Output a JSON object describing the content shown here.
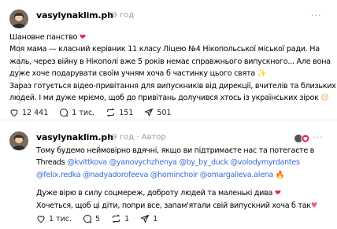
{
  "post1": {
    "username": "vasylynaklim.ph",
    "time": "19 год",
    "more": "···",
    "greeting": "Шановне панство",
    "body_lines": [
      "Моя мама — класний керівник 11 класу Ліцею №4 Нікопольської міської ради. На",
      "жаль, через війну в Нікополі вже 5 років немає справжнього випускного... Але вона",
      "дуже хоче подарувати своїм учням хоча б частинку цього свята",
      "Зараз готується відео-привітання для випускників від дирекції, вчителів та близьких",
      "людей. І ми дуже мріємо, щоб до привітань долучився хтось із українських зірок"
    ],
    "likes": "12 441",
    "comments": "1 тис.",
    "reposts": "151",
    "shares": "501"
  },
  "post2": {
    "username": "vasylynaklim.ph",
    "time": "19 год",
    "author_label": "Автор",
    "more": "···",
    "lines": [
      "Тому будемо неймовірно вдячні, якщо ви підтримаєте нас та потегаєте в",
      "Threads"
    ],
    "mentions_line1": [
      "@kvittkova",
      "@yanovychzhenya",
      "@by_by_duck",
      "@volodymyrdantes"
    ],
    "mentions_line2": [
      "@felix.redka",
      "@nadyadorofeeva",
      "@hominchoir",
      "@omargalieva.alena"
    ],
    "closing_lines": [
      "Дуже вірю в силу соцмереж, доброту людей та маленькі дива",
      "Хочеться, щоб ці діти, попри все, запам'ятали свій випускний хоча б так"
    ],
    "likes": "1 тис.",
    "comments": "5",
    "reposts": "1",
    "shares": "1"
  }
}
